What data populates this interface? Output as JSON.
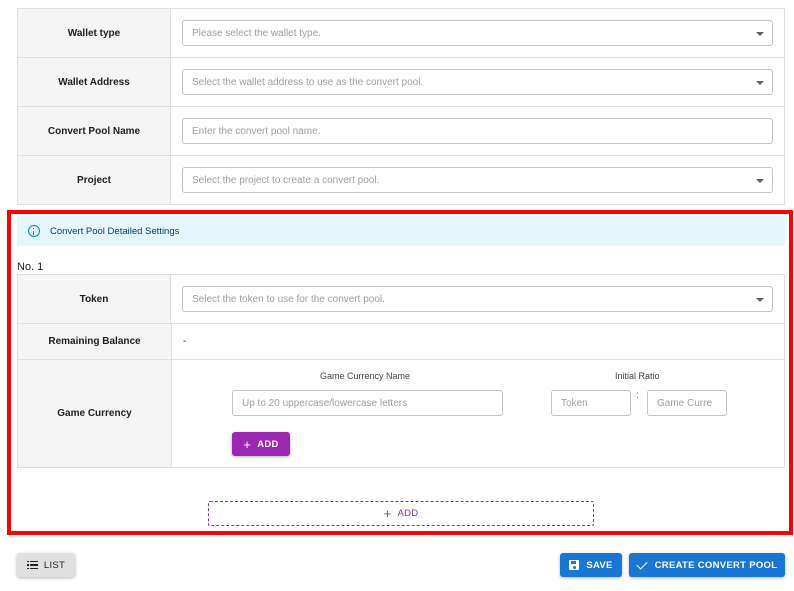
{
  "form": {
    "wallet_type": {
      "label": "Wallet type",
      "placeholder": "Please select the wallet type."
    },
    "wallet_address": {
      "label": "Wallet Address",
      "placeholder": "Select the wallet address to use as the convert pool."
    },
    "pool_name": {
      "label": "Convert Pool Name",
      "placeholder": "Enter the convert pool name."
    },
    "project": {
      "label": "Project",
      "placeholder": "Select the project to create a convert pool."
    }
  },
  "detail": {
    "info_text": "Convert Pool Detailed Settings",
    "item_number": "No. 1",
    "token": {
      "label": "Token",
      "placeholder": "Select the token to use for the convert pool."
    },
    "remaining_balance": {
      "label": "Remaining Balance",
      "value": "-"
    },
    "game_currency": {
      "label": "Game Currency",
      "name_header": "Game Currency Name",
      "ratio_header": "Initial Ratio",
      "name_placeholder": "Up to 20 uppercase/lowercase letters",
      "token_placeholder": "Token",
      "separator": ":",
      "currency_placeholder": "Game Curre",
      "add_label": "ADD"
    },
    "add_pool_label": "ADD"
  },
  "actions": {
    "list_label": "LIST",
    "save_label": "SAVE",
    "create_label": "CREATE CONVERT POOL"
  },
  "colors": {
    "primary": "#1976d2",
    "secondary": "#9c27b0",
    "highlight": "#ff0000",
    "info_bg": "#e5f6fd"
  }
}
